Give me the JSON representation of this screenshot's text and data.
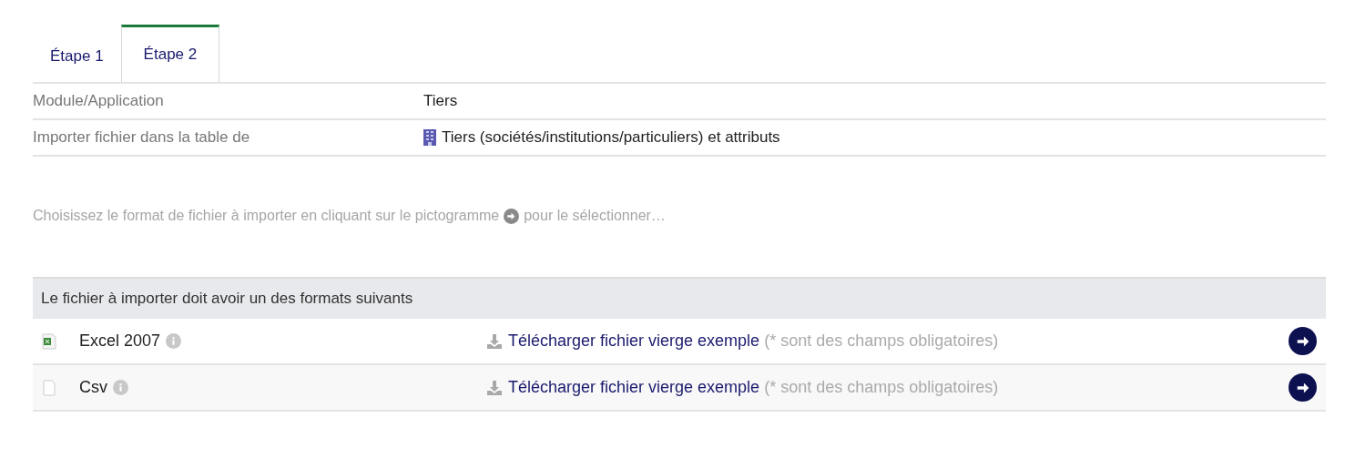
{
  "tabs": [
    {
      "label": "Étape 1",
      "selected": false
    },
    {
      "label": "Étape 2",
      "selected": true
    }
  ],
  "info": [
    {
      "label": "Module/Application",
      "value": "Tiers"
    },
    {
      "label": "Importer fichier dans la table de",
      "value": "Tiers (sociétés/institutions/particuliers) et attributs",
      "kind": "building"
    }
  ],
  "instruction": {
    "before": "Choisissez le format de fichier à importer en cliquant sur le pictogramme",
    "after": "pour le sélectionner…"
  },
  "formats": {
    "header": "Le fichier à importer doit avoir un des formats suivants",
    "rows": [
      {
        "kind": "excel",
        "name": "Excel 2007",
        "link": "Télécharger fichier vierge exemple",
        "note": "(* sont des champs obligatoires)"
      },
      {
        "kind": "csv",
        "name": "Csv",
        "link": "Télécharger fichier vierge exemple",
        "note": "(* sont des champs obligatoires)"
      }
    ]
  }
}
